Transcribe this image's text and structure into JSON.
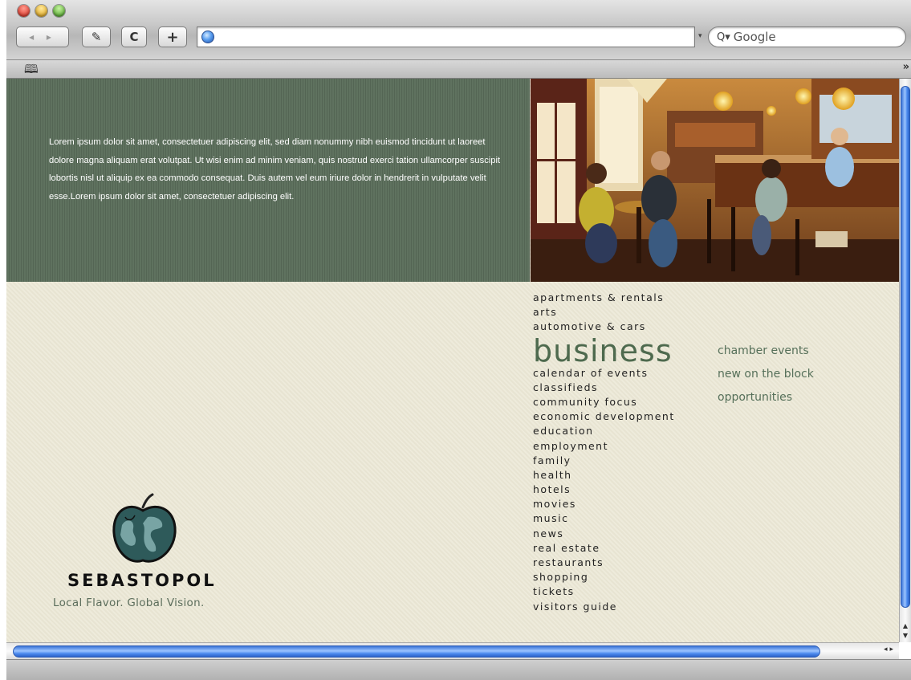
{
  "window": {
    "search_placeholder": "Google",
    "url": ""
  },
  "toolbar": {
    "back_forward_label": "◂ ▸",
    "edit_label": "✎",
    "reload_label": "C",
    "add_label": "+"
  },
  "page": {
    "intro_text": "Lorem ipsum dolor sit amet, consectetuer adipiscing elit, sed diam nonummy nibh euismod tincidunt ut laoreet dolore magna aliquam erat volutpat.  Ut wisi enim ad minim veniam, quis nostrud exerci tation ullamcorper suscipit lobortis nisl ut aliquip ex ea commodo consequat.  Duis autem vel eum iriure dolor in hendrerit in vulputate velit esse.Lorem ipsum dolor sit amet, consectetuer adipiscing elit.",
    "logo_name": "SEBASTOPOL",
    "logo_tagline": "Local Flavor. Global Vision.",
    "nav": [
      "apartments & rentals",
      "arts",
      "automotive & cars",
      "business",
      "calendar of events",
      "classifieds",
      "community focus",
      "economic development",
      "education",
      "employment",
      "family",
      "health",
      "hotels",
      "movies",
      "music",
      "news",
      "real estate",
      "restaurants",
      "shopping",
      "tickets",
      "visitors guide"
    ],
    "active_nav": "business",
    "subnav": [
      "chamber events",
      "new on the block",
      "opportunities"
    ]
  },
  "colors": {
    "header_green": "#5a6d5a",
    "page_bg": "#ece8d6",
    "active_nav": "#4e6a4e",
    "subnav": "#56705a",
    "scroll_blue": "#4c8aee"
  }
}
